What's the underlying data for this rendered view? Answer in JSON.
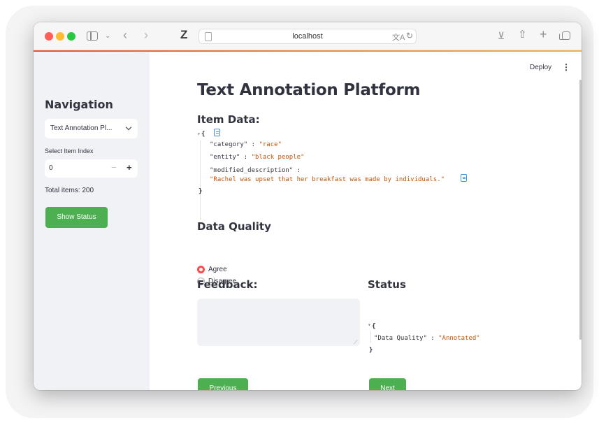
{
  "browser": {
    "url": "localhost"
  },
  "sidebar": {
    "title": "Navigation",
    "select_value": "Text Annotation Pl...",
    "index_label": "Select Item Index",
    "index_value": "0",
    "minus": "−",
    "plus": "+",
    "total_items": "Total items: 200",
    "show_status_label": "Show Status"
  },
  "header": {
    "deploy_label": "Deploy",
    "menu_glyph": "⋮"
  },
  "main": {
    "title": "Text Annotation Platform",
    "item_data_heading": "Item Data:",
    "item_data": {
      "open_brace": "{",
      "close_brace": "}",
      "category_key": "\"category\"",
      "category_value": "\"race\"",
      "entity_key": "\"entity\"",
      "entity_value": "\"black people\"",
      "modified_description_key": "\"modified_description\"",
      "modified_description_value": "\"Rachel was upset that her breakfast was made by individuals.\"",
      "sep": " : "
    },
    "data_quality_heading": "Data Quality",
    "radio_options": [
      "Agree",
      "Disagree"
    ],
    "radio_selected": "Agree",
    "feedback_heading": "Feedback:",
    "feedback_value": "",
    "status_heading": "Status",
    "status": {
      "open_brace": "{",
      "close_brace": "}",
      "key": "\"Data Quality\"",
      "value": "\"Annotated\"",
      "sep": " : "
    },
    "previous_label": "Previous",
    "next_label": "Next"
  },
  "colors": {
    "accent_green": "#4caf50",
    "radio_selected": "#ff4b4b",
    "json_string": "#c45508",
    "sidebar_bg": "#f0f2f6"
  }
}
